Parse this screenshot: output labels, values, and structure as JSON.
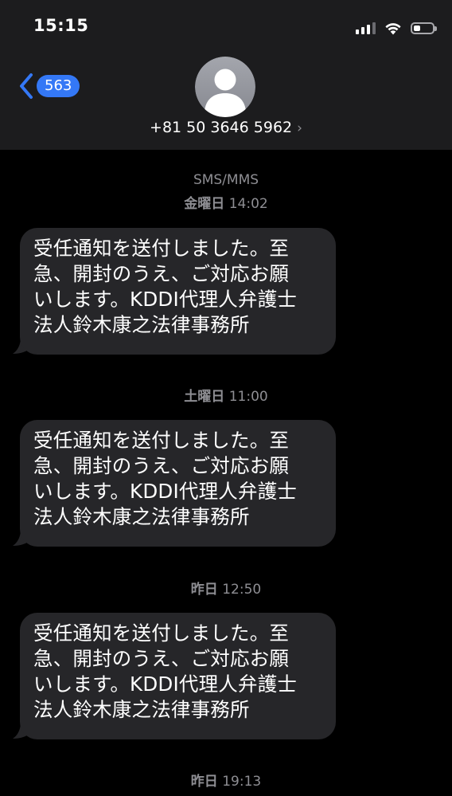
{
  "status_bar": {
    "time": "15:15",
    "battery_level": 0.35,
    "signal_bars": 3,
    "icons": [
      "signal-icon",
      "wifi-icon",
      "battery-icon"
    ]
  },
  "nav": {
    "back_count": "563",
    "contact": "+81 50 3646 5962",
    "chevron": "›",
    "avatar_icon": "person-silhouette-icon"
  },
  "conversation": {
    "service": "SMS/MMS",
    "groups": [
      {
        "day": "金曜日",
        "time": "14:02",
        "message": "受任通知を送付しました。至\n急、開封のうえ、ご対応お願\nいします。KDDI代理人弁護士\n法人鈴木康之法律事務所"
      },
      {
        "day": "土曜日",
        "time": "11:00",
        "message": "受任通知を送付しました。至\n急、開封のうえ、ご対応お願\nいします。KDDI代理人弁護士\n法人鈴木康之法律事務所"
      },
      {
        "day": "昨日",
        "time": "12:50",
        "message": "受任通知を送付しました。至\n急、開封のうえ、ご対応お願\nいします。KDDI代理人弁護士\n法人鈴木康之法律事務所"
      },
      {
        "day": "昨日",
        "time": "19:13",
        "message": ""
      }
    ]
  },
  "colors": {
    "background": "#000000",
    "header": "#1c1c1e",
    "bubble": "#262629",
    "accent": "#3478f6",
    "secondary_text": "#8e8e93"
  }
}
